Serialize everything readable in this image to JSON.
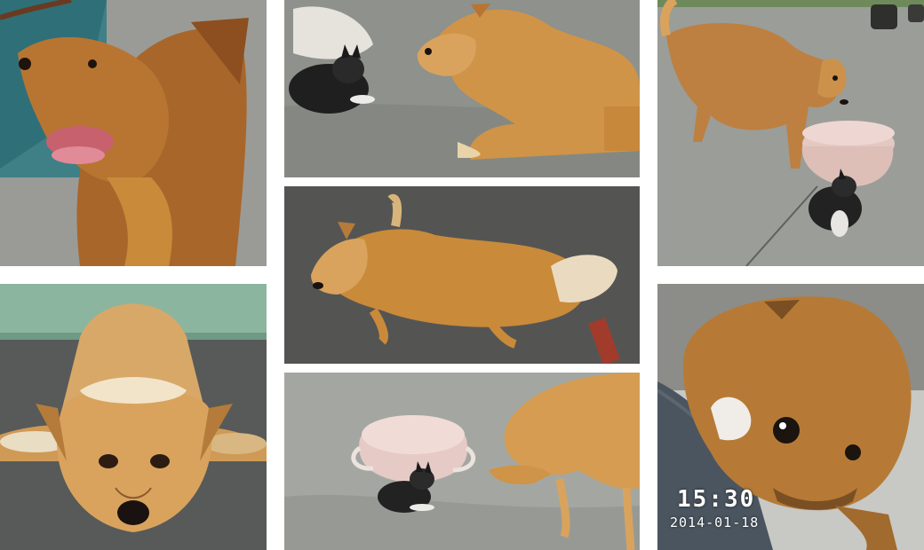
{
  "photos": [
    {
      "subject": "dog-closeup-yawning"
    },
    {
      "subject": "dog-lying-looking-up"
    },
    {
      "subject": "dog-with-cat-figurine"
    },
    {
      "subject": "dog-lying-on-side"
    },
    {
      "subject": "dog-near-bowl-and-cat-figurine"
    },
    {
      "subject": "dog-standing-near-bowl"
    },
    {
      "subject": "puppy-on-lap"
    }
  ],
  "timestamp": {
    "time": "15:30",
    "date": "2014-01-18"
  },
  "colors": {
    "fur": "#c98a3a",
    "fur_light": "#e8c089",
    "concrete": "#8f928c",
    "background": "#ffffff"
  }
}
